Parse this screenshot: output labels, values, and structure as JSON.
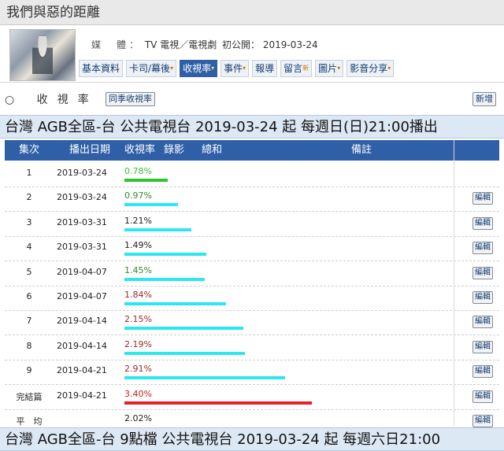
{
  "page": {
    "title": "我們與惡的距離"
  },
  "meta": {
    "media_label": "媒　體：",
    "media_value": "TV 電視／電視劇",
    "premiere_label": "初公開：",
    "premiere_value": "2019-03-24"
  },
  "tabs": [
    {
      "label": "基本資料",
      "mark": ""
    },
    {
      "label": "卡司/幕後",
      "mark": "▾"
    },
    {
      "label": "收視率",
      "mark": "▾"
    },
    {
      "label": "事件",
      "mark": "▾"
    },
    {
      "label": "報導",
      "mark": ""
    },
    {
      "label": "留言",
      "mark": "新"
    },
    {
      "label": "圖片",
      "mark": "▾"
    },
    {
      "label": "影音分享",
      "mark": "▾"
    }
  ],
  "ratings": {
    "heading": "○ 收視率",
    "same_season_button": "同季收視率",
    "add_button": "新增"
  },
  "banner1": "台灣 AGB全區-台 公共電視台 2019-03-24 起 每週日(日)21:00播出",
  "banner2": "台灣 AGB全區-台 9點檔 公共電視台 2019-03-24 起 每週六日21:00",
  "table": {
    "headers": {
      "ep": "集次",
      "date": "播出日期",
      "rating": "收視率",
      "rec": "錄影",
      "total": "總和",
      "note": "備註"
    },
    "edit_label": "編輯",
    "rows": [
      {
        "ep": "1",
        "date": "2019-03-24",
        "rating": "0.78%",
        "value": 0.78,
        "color": "#2fc52f",
        "text_color": "#3bbf3b",
        "edit": false
      },
      {
        "ep": "2",
        "date": "2019-03-24",
        "rating": "0.97%",
        "value": 0.97,
        "color": "#2ee6f2",
        "text_color": "#2e8b2e",
        "edit": true
      },
      {
        "ep": "3",
        "date": "2019-03-31",
        "rating": "1.21%",
        "value": 1.21,
        "color": "#2ee6f2",
        "text_color": "#222222",
        "edit": true
      },
      {
        "ep": "4",
        "date": "2019-03-31",
        "rating": "1.49%",
        "value": 1.49,
        "color": "#2ee6f2",
        "text_color": "#222222",
        "edit": true
      },
      {
        "ep": "5",
        "date": "2019-04-07",
        "rating": "1.45%",
        "value": 1.45,
        "color": "#2ee6f2",
        "text_color": "#2e8b2e",
        "edit": true
      },
      {
        "ep": "6",
        "date": "2019-04-07",
        "rating": "1.84%",
        "value": 1.84,
        "color": "#2ee6f2",
        "text_color": "#a0282c",
        "edit": true
      },
      {
        "ep": "7",
        "date": "2019-04-14",
        "rating": "2.15%",
        "value": 2.15,
        "color": "#2ee6f2",
        "text_color": "#a0282c",
        "edit": true
      },
      {
        "ep": "8",
        "date": "2019-04-14",
        "rating": "2.19%",
        "value": 2.19,
        "color": "#2ee6f2",
        "text_color": "#a0282c",
        "edit": true
      },
      {
        "ep": "9",
        "date": "2019-04-21",
        "rating": "2.91%",
        "value": 2.91,
        "color": "#2ee6f2",
        "text_color": "#a0282c",
        "edit": true
      },
      {
        "ep": "完結篇",
        "date": "2019-04-21",
        "rating": "3.40%",
        "value": 3.4,
        "color": "#e52222",
        "text_color": "#c81e1e",
        "edit": true
      },
      {
        "ep": "平　均",
        "date": "",
        "rating": "2.02%",
        "value": null,
        "color": "",
        "text_color": "#222222",
        "edit": true
      }
    ]
  }
}
